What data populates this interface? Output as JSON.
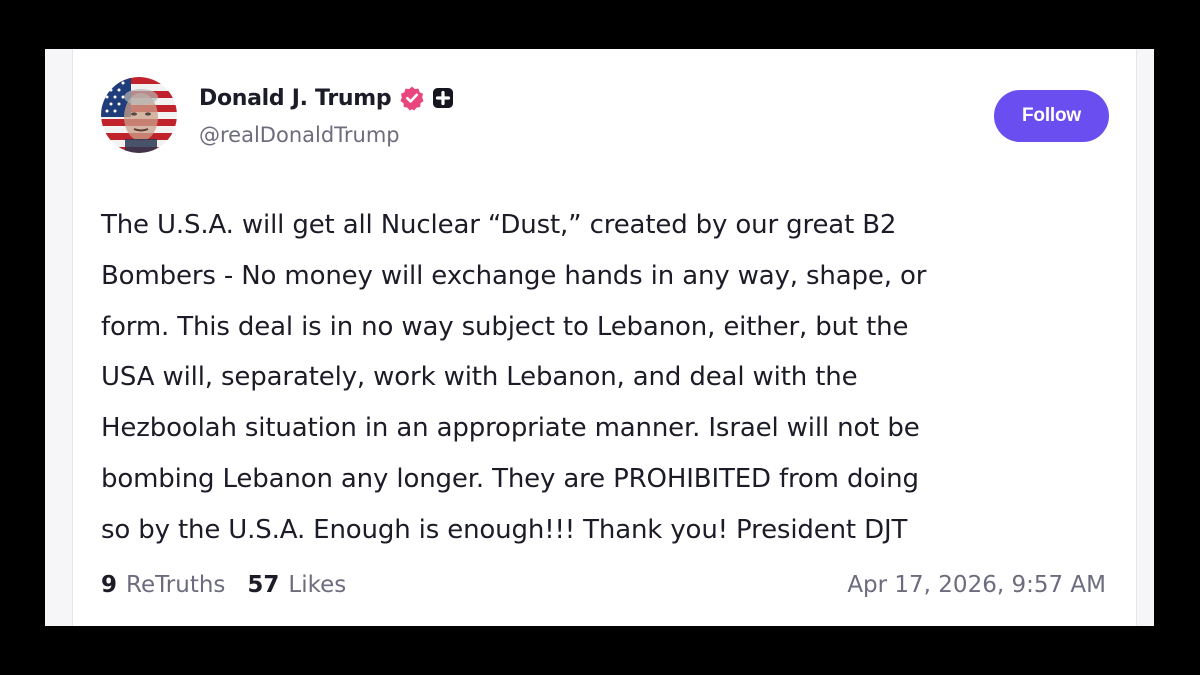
{
  "post": {
    "author": {
      "display_name": "Donald J. Trump",
      "handle": "@realDonaldTrump",
      "verified_icon": "verified-badge-icon",
      "plus_icon": "plus-square-icon",
      "avatar_icon": "avatar-flag-portrait"
    },
    "follow_label": "Follow",
    "body_lines": [
      "The U.S.A. will get all Nuclear “Dust,” created by our great B2",
      "Bombers - No money will exchange hands in any way, shape, or",
      "form. This deal is in no way subject to Lebanon, either, but the",
      "USA will, separately, work with Lebanon, and deal with the",
      "Hezboolah situation in an appropriate manner. Israel will not be",
      "bombing Lebanon any longer. They are PROHIBITED from doing",
      "so by the U.S.A. Enough is enough!!! Thank you! President DJT"
    ],
    "stats": {
      "retruths_count": "9",
      "retruths_label": "ReTruths",
      "likes_count": "57",
      "likes_label": "Likes"
    },
    "timestamp": "Apr 17, 2026, 9:57 AM"
  },
  "colors": {
    "accent": "#6a4ef0",
    "verified": "#e8467c",
    "text_primary": "#1c1c28",
    "text_secondary": "#6c6c7e",
    "page_background": "#000000"
  }
}
